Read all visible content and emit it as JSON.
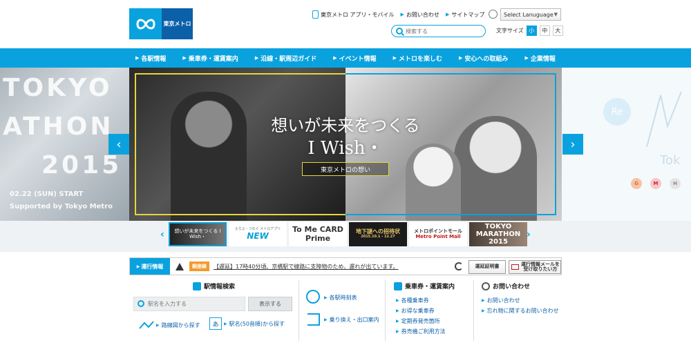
{
  "header": {
    "logo_text": "東京メトロ",
    "links": [
      {
        "label": "東京メトロ アプリ・モバイル",
        "icon": "phone-icon"
      },
      {
        "label": "お問い合わせ",
        "icon": "arrow"
      },
      {
        "label": "サイトマップ",
        "icon": "arrow"
      }
    ],
    "language_select": "Select Lanuguage",
    "search_placeholder": "検索する",
    "font_size_label": "文字サイズ",
    "font_sizes": [
      "小",
      "中",
      "大"
    ],
    "font_size_selected": "小"
  },
  "nav": {
    "items": [
      "各駅情報",
      "乗車券・運賃案内",
      "沿線・駅周辺ガイド",
      "イベント情報",
      "メトロを楽しむ",
      "安心への取組み",
      "企業情報"
    ]
  },
  "hero": {
    "headline": "想いが未来をつくる",
    "subline": "I Wish・",
    "cta": "東京メトロの想い",
    "left_banner": {
      "line1": "TOKYO",
      "line2": "ATHON",
      "line3": "2015",
      "date": "02.22 (SUN) START",
      "support": "Supported by Tokyo Metro"
    },
    "right_banner": {
      "badge": "Re",
      "text": "Tok",
      "dots": [
        "G",
        "M",
        "H"
      ]
    }
  },
  "thumbs": {
    "items": [
      {
        "text": "想いが未来をつくる I Wish・"
      },
      {
        "text": "NEW",
        "sub": "えらぶ・つなぐ メトロアプリ"
      },
      {
        "text": "To Me CARD Prime"
      },
      {
        "text": "地下謎への招待状",
        "sub": "2015.10.1 - 12.27"
      },
      {
        "text": "メトロポイントモール",
        "sub": "Metro Point Mall"
      },
      {
        "text": "TOKYO MARATHON 2015"
      }
    ]
  },
  "operation": {
    "label": "運行情報",
    "line": "銀座線",
    "message": "【遅延】17時40分頃、京橋駅で線路に支障物のため、遅れが出ています。",
    "cert_button": "運延証明書",
    "mail_button": "運行情報メールを受け取りたい方"
  },
  "panels": {
    "station_search": {
      "title": "駅情報検索",
      "input_placeholder": "駅名を入力する",
      "button": "表示する",
      "link_route": "路線図から探す",
      "link_kana": "駅名(50音順)から探す",
      "kana_glyph": "あ"
    },
    "timetable": {
      "link1": "各駅時刻表",
      "link2": "乗り換え・出口案内"
    },
    "tickets": {
      "title": "乗車券・運賃案内",
      "links": [
        "各種乗車券",
        "お得な乗車券",
        "定期券発売箇所",
        "券売機ご利用方法"
      ]
    },
    "contact": {
      "title": "お問い合わせ",
      "links": [
        "お問い合わせ",
        "忘れ物に関するお問い合わせ"
      ]
    }
  },
  "colors": {
    "accent": "#0aa2de",
    "brand_dark": "#0b60a8",
    "line_ginza": "#f39a2b"
  }
}
